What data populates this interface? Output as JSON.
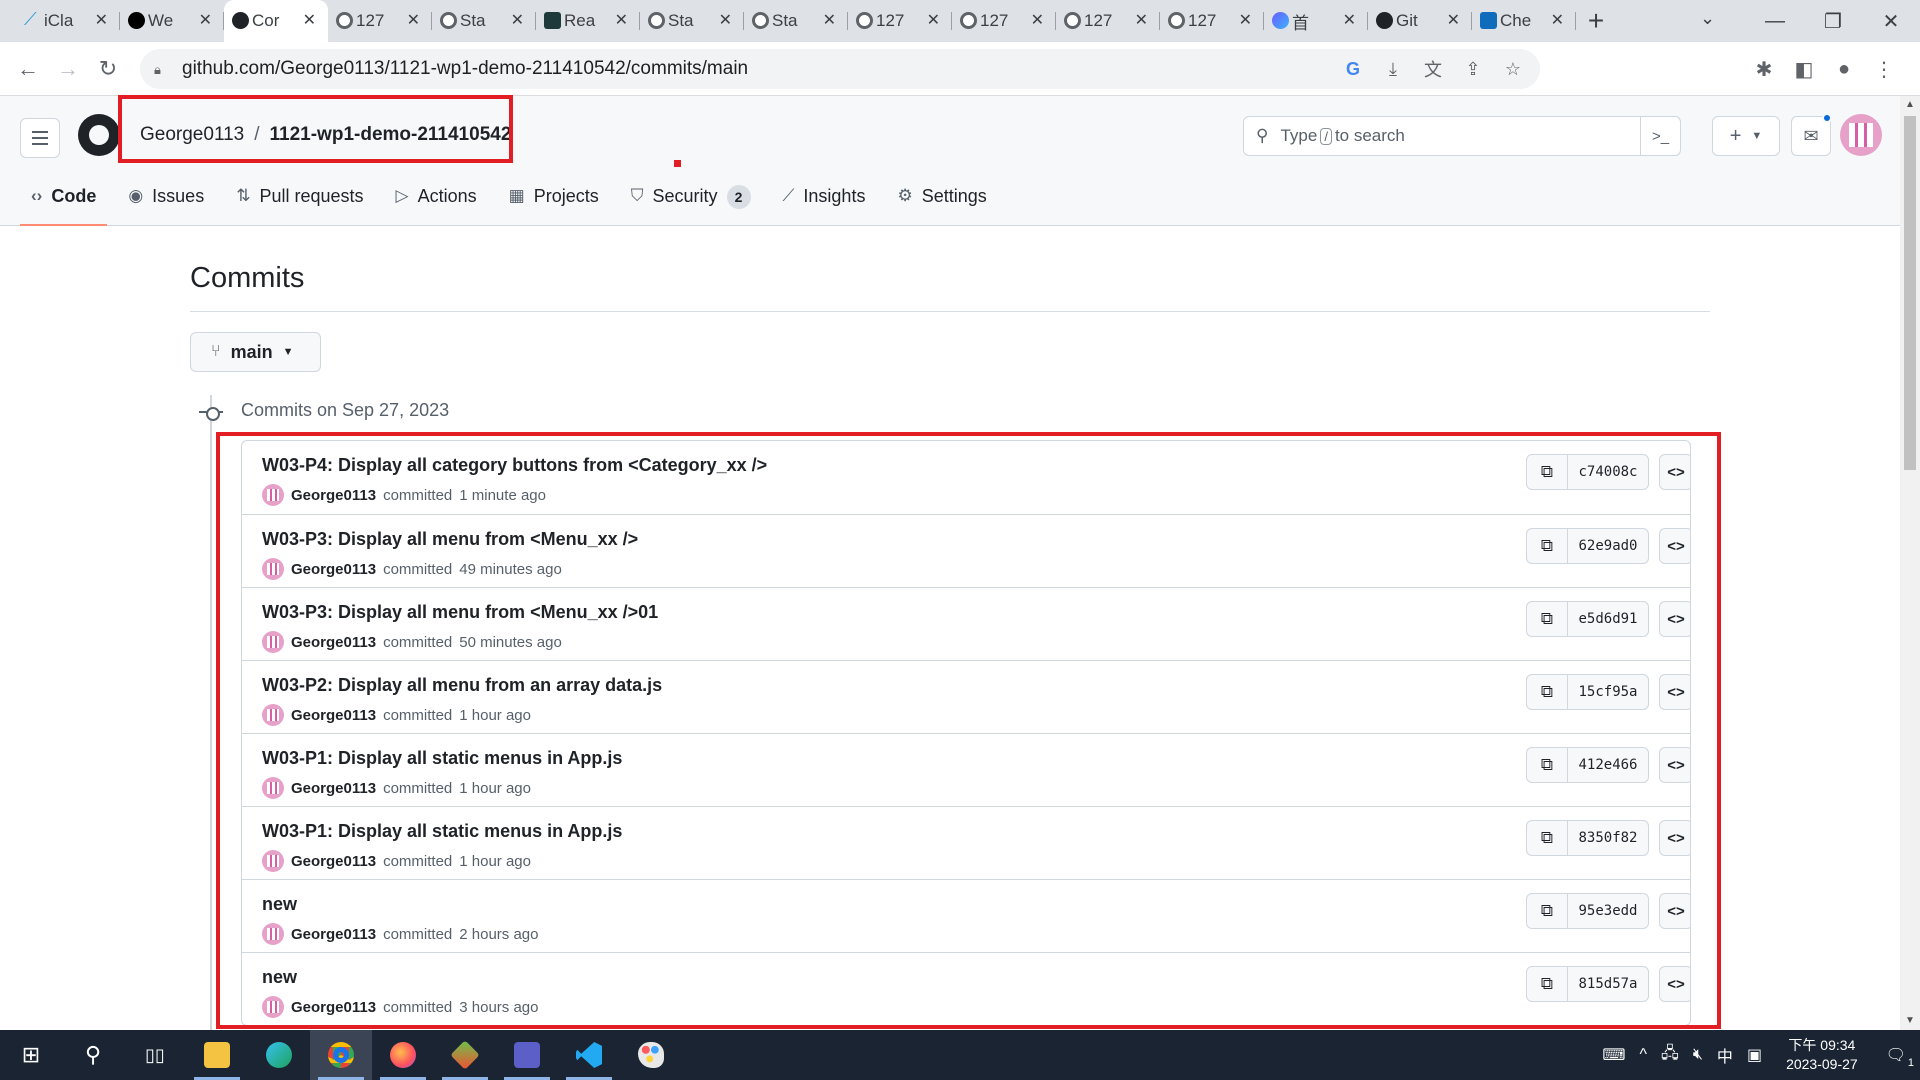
{
  "browser": {
    "tabs": [
      {
        "title": "iCla",
        "icon": "icla-icon"
      },
      {
        "title": "We",
        "icon": "vercel-icon"
      },
      {
        "title": "Cor",
        "icon": "github-icon",
        "active": true
      },
      {
        "title": "127",
        "icon": "globe-icon"
      },
      {
        "title": "Sta",
        "icon": "globe-icon"
      },
      {
        "title": "Rea",
        "icon": "react-icon"
      },
      {
        "title": "Sta",
        "icon": "globe-icon"
      },
      {
        "title": "Sta",
        "icon": "globe-icon"
      },
      {
        "title": "127",
        "icon": "globe-icon"
      },
      {
        "title": "127",
        "icon": "globe-icon"
      },
      {
        "title": "127",
        "icon": "globe-icon"
      },
      {
        "title": "127",
        "icon": "globe-icon"
      },
      {
        "title": "首",
        "icon": "copilot-icon"
      },
      {
        "title": "Git",
        "icon": "github-icon"
      },
      {
        "title": "Che",
        "icon": "outlook-icon"
      }
    ],
    "url": "github.com/George0113/1121-wp1-demo-211410542/commits/main"
  },
  "github": {
    "owner": "George0113",
    "separator": "/",
    "repo": "1121-wp1-demo-211410542",
    "search": {
      "prefix": "Type",
      "key": "/",
      "suffix": "to search"
    },
    "nav": [
      {
        "label": "Code",
        "icon": "code-icon",
        "selected": true
      },
      {
        "label": "Issues",
        "icon": "issue-icon"
      },
      {
        "label": "Pull requests",
        "icon": "pull-request-icon"
      },
      {
        "label": "Actions",
        "icon": "play-icon"
      },
      {
        "label": "Projects",
        "icon": "table-icon"
      },
      {
        "label": "Security",
        "icon": "shield-icon",
        "counter": "2"
      },
      {
        "label": "Insights",
        "icon": "graph-icon"
      },
      {
        "label": "Settings",
        "icon": "gear-icon"
      }
    ]
  },
  "page": {
    "title": "Commits",
    "branch": "main",
    "date_heading": "Commits on Sep 27, 2023"
  },
  "commits": [
    {
      "message": "W03-P4: Display all category buttons from <Category_xx />",
      "author": "George0113",
      "verb": "committed",
      "time": "1 minute ago",
      "sha": "c74008c"
    },
    {
      "message": "W03-P3: Display all menu from <Menu_xx />",
      "author": "George0113",
      "verb": "committed",
      "time": "49 minutes ago",
      "sha": "62e9ad0"
    },
    {
      "message": "W03-P3: Display all menu from <Menu_xx />01",
      "author": "George0113",
      "verb": "committed",
      "time": "50 minutes ago",
      "sha": "e5d6d91"
    },
    {
      "message": "W03-P2: Display all menu from an array data.js",
      "author": "George0113",
      "verb": "committed",
      "time": "1 hour ago",
      "sha": "15cf95a"
    },
    {
      "message": "W03-P1: Display all static menus in App.js",
      "author": "George0113",
      "verb": "committed",
      "time": "1 hour ago",
      "sha": "412e466"
    },
    {
      "message": "W03-P1: Display all static menus in App.js",
      "author": "George0113",
      "verb": "committed",
      "time": "1 hour ago",
      "sha": "8350f82"
    },
    {
      "message": "new",
      "author": "George0113",
      "verb": "committed",
      "time": "2 hours ago",
      "sha": "95e3edd"
    },
    {
      "message": "new",
      "author": "George0113",
      "verb": "committed",
      "time": "3 hours ago",
      "sha": "815d57a"
    }
  ],
  "taskbar": {
    "clock_time": "下午 09:34",
    "clock_date": "2023-09-27",
    "ime": "中",
    "notifications": "1"
  },
  "colors": {
    "highlight": "#e21d23",
    "tab_underline": "#fd8c73",
    "accent_blue": "#0969da"
  }
}
